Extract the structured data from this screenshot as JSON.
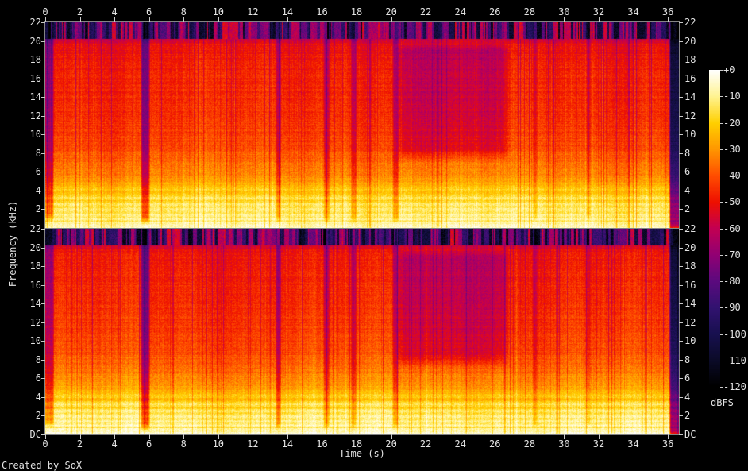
{
  "credit": "Created by SoX",
  "axes": {
    "time_label": "Time (s)",
    "freq_label": "Frequency (kHz)",
    "time_tick_labels": [
      "0",
      "2",
      "4",
      "6",
      "8",
      "10",
      "12",
      "14",
      "16",
      "18",
      "20",
      "22",
      "24",
      "26",
      "28",
      "30",
      "32",
      "34",
      "36"
    ],
    "freq_tick_labels_ch1": [
      "22",
      "20",
      "18",
      "16",
      "14",
      "12",
      "10",
      "8",
      "6",
      "4",
      "2"
    ],
    "freq_tick_labels_ch2": [
      "22",
      "20",
      "18",
      "16",
      "14",
      "12",
      "10",
      "8",
      "6",
      "4",
      "2",
      "DC"
    ]
  },
  "colorbar": {
    "label": "dBFS",
    "ticks": [
      "+0",
      "-10",
      "-20",
      "-30",
      "-40",
      "-50",
      "-60",
      "-70",
      "-80",
      "-90",
      "-100",
      "-110",
      "-120"
    ]
  },
  "chart_data": {
    "type": "heatmap",
    "subtype": "audio-spectrogram",
    "title": "",
    "xlabel": "Time (s)",
    "ylabel": "Frequency (kHz)",
    "zlabel": "dBFS",
    "channels": 2,
    "x_range_s": [
      0,
      36.65
    ],
    "x_ticks": [
      0,
      2,
      4,
      6,
      8,
      10,
      12,
      14,
      16,
      18,
      20,
      22,
      24,
      26,
      28,
      30,
      32,
      34,
      36
    ],
    "y_range_khz": [
      0,
      22
    ],
    "y_ticks_khz": [
      22,
      20,
      18,
      16,
      14,
      12,
      10,
      8,
      6,
      4,
      2,
      0
    ],
    "z_range_db": [
      -120,
      0
    ],
    "z_ticks_db": [
      0,
      -10,
      -20,
      -30,
      -40,
      -50,
      -60,
      -70,
      -80,
      -90,
      -100,
      -110,
      -120
    ],
    "legend_position": "right-colorbar",
    "grid": false,
    "palette_stops": [
      [
        0.0,
        "#000000"
      ],
      [
        0.083,
        "#0b0b28"
      ],
      [
        0.167,
        "#181050"
      ],
      [
        0.25,
        "#321270"
      ],
      [
        0.333,
        "#5c0a7e"
      ],
      [
        0.417,
        "#920073"
      ],
      [
        0.5,
        "#c30052"
      ],
      [
        0.583,
        "#ee1000"
      ],
      [
        0.667,
        "#ff4e00"
      ],
      [
        0.75,
        "#ff9700"
      ],
      [
        0.833,
        "#ffd000"
      ],
      [
        0.917,
        "#fff391"
      ],
      [
        1.0,
        "#ffffff"
      ]
    ],
    "features": {
      "high_band_start_khz": 20.25,
      "beat_period_s": 0.469,
      "freq_profile_db": [
        [
          0,
          -8
        ],
        [
          0.4,
          -10
        ],
        [
          1,
          -13
        ],
        [
          2,
          -15
        ],
        [
          3,
          -18
        ],
        [
          4,
          -23
        ],
        [
          5,
          -29
        ],
        [
          6.5,
          -35
        ],
        [
          9,
          -42
        ],
        [
          13,
          -46
        ],
        [
          18,
          -49
        ],
        [
          19.7,
          -52
        ],
        [
          20.25,
          -58
        ],
        [
          22,
          -60
        ]
      ],
      "low_freq_bands": [
        {
          "f_khz": 0.12,
          "gain": 4,
          "width_khz": 0.06
        },
        {
          "f_khz": 0.5,
          "gain": 3,
          "width_khz": 0.1
        },
        {
          "f_khz": 0.95,
          "gain": 5,
          "width_khz": 0.09
        },
        {
          "f_khz": 1.4,
          "gain": 3.5,
          "width_khz": 0.1
        },
        {
          "f_khz": 1.9,
          "gain": 4,
          "width_khz": 0.12
        },
        {
          "f_khz": 2.5,
          "gain": 3.5,
          "width_khz": 0.12
        },
        {
          "f_khz": 3.2,
          "gain": 4,
          "width_khz": 0.15
        },
        {
          "f_khz": 4.1,
          "gain": 3,
          "width_khz": 0.18
        },
        {
          "f_khz": 0.72,
          "gain": -4,
          "width_khz": 0.07
        },
        {
          "f_khz": 1.65,
          "gain": -3,
          "width_khz": 0.08
        },
        {
          "f_khz": 2.85,
          "gain": -3,
          "width_khz": 0.1
        },
        {
          "f_khz": 3.7,
          "gain": -2.5,
          "width_khz": 0.12
        }
      ],
      "gaps": [
        {
          "t0": 0.0,
          "t1": 0.45,
          "depth": 22,
          "fmin_khz": 1.2
        },
        {
          "t0": 5.55,
          "t1": 5.98,
          "depth": 30,
          "fmin_khz": 0.9
        },
        {
          "t0": 13.35,
          "t1": 13.6,
          "depth": 18,
          "fmin_khz": 1.0
        },
        {
          "t0": 16.1,
          "t1": 16.4,
          "depth": 16,
          "fmin_khz": 1.0
        },
        {
          "t0": 17.7,
          "t1": 17.95,
          "depth": 14,
          "fmin_khz": 1.0
        },
        {
          "t0": 20.1,
          "t1": 20.4,
          "depth": 16,
          "fmin_khz": 1.0
        },
        {
          "t0": 28.2,
          "t1": 28.4,
          "depth": 10,
          "fmin_khz": 1.2
        },
        {
          "t0": 31.3,
          "t1": 31.5,
          "depth": 10,
          "fmin_khz": 1.2
        },
        {
          "t0": 36.12,
          "t1": 36.8,
          "depth": 55,
          "fmin_khz": 0.0
        }
      ],
      "quiet_section": {
        "t0": 20.5,
        "t1": 26.6,
        "f0_khz": 8,
        "f1_khz": 19.5,
        "depth_db": 13
      }
    }
  }
}
